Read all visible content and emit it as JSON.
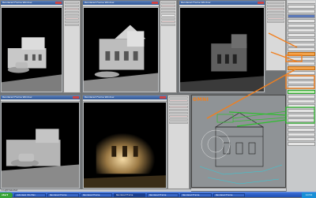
{
  "windows": [
    {
      "title": "Rendered Frame Window"
    },
    {
      "title": "Rendered Frame Window"
    },
    {
      "title": "Rendered Frame Window"
    },
    {
      "title": "Rendered Frame Window"
    },
    {
      "title": "Rendered Frame Window"
    }
  ],
  "viewport": {
    "label": "OMNI"
  },
  "status": {
    "text": "1 Light Selected"
  },
  "taskbar": {
    "start_label": "start",
    "items": [
      "Autodesk 3ds Max",
      "Rendered Frame",
      "Rendered Frame",
      "Rendered Frame",
      "Rendered Frame",
      "Rendered Frame",
      "Rendered Frame"
    ],
    "clock": "10:54"
  },
  "colors": {
    "highlight_orange": "#f07f1e",
    "highlight_green": "#2fbf2f",
    "render_bg": "#000000"
  }
}
